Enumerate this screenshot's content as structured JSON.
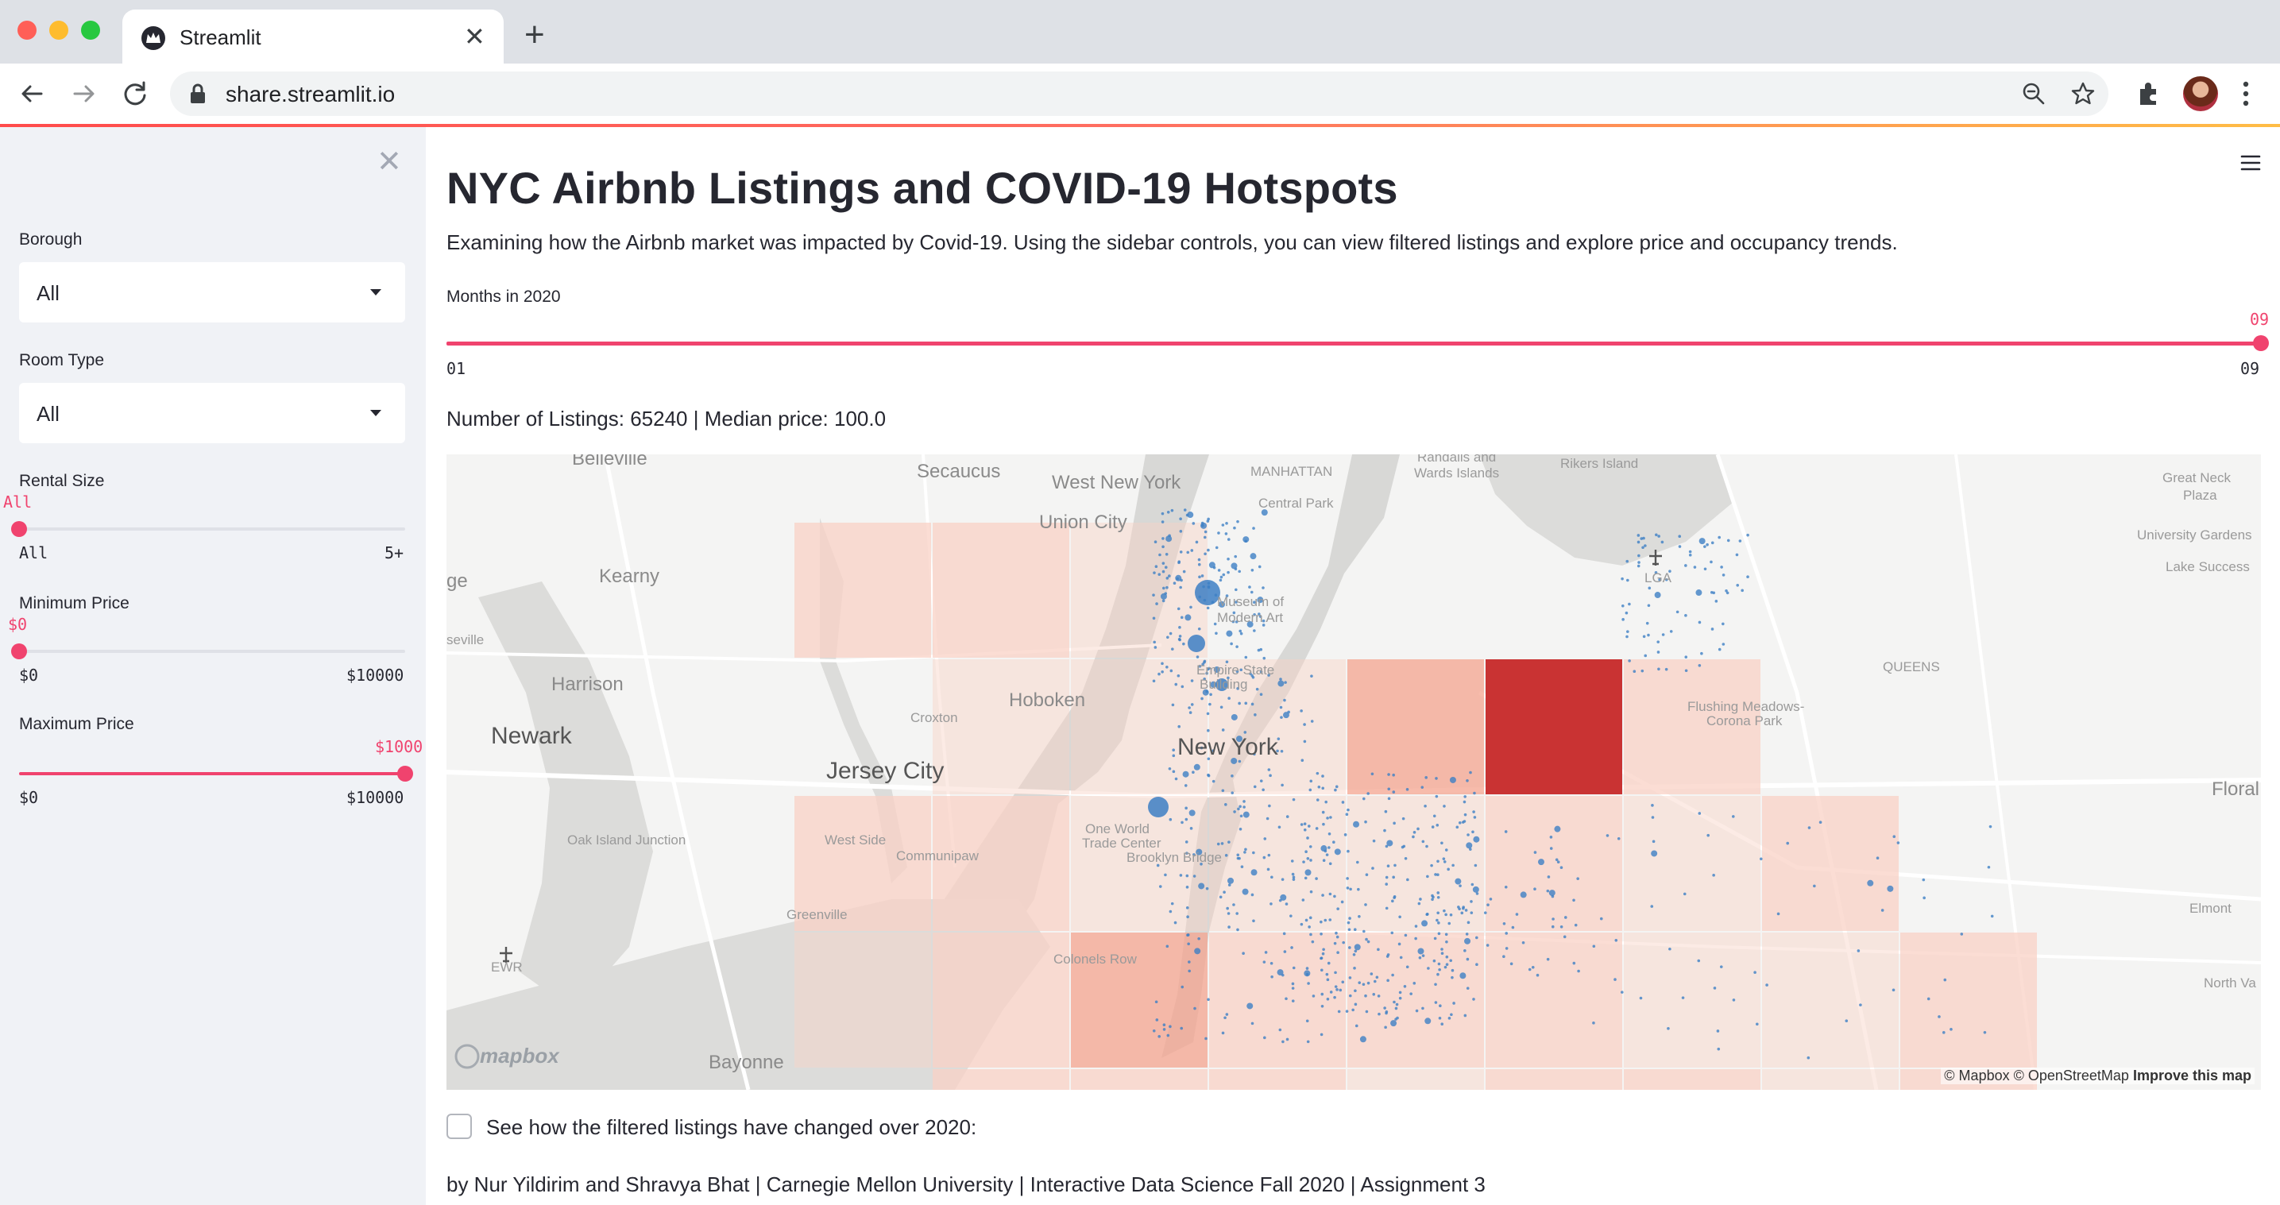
{
  "browser": {
    "tab_title": "Streamlit",
    "url": "share.streamlit.io",
    "icons": [
      "back-arrow-icon",
      "forward-arrow-icon",
      "reload-icon",
      "lock-icon",
      "zoom-icon",
      "star-icon",
      "extensions-icon",
      "profile-avatar",
      "kebab-menu-icon"
    ]
  },
  "sidebar": {
    "borough": {
      "label": "Borough",
      "value": "All"
    },
    "room_type": {
      "label": "Room Type",
      "value": "All"
    },
    "rental_size": {
      "label": "Rental Size",
      "value": "All",
      "min": "All",
      "max": "5+",
      "position": 0
    },
    "min_price": {
      "label": "Minimum Price",
      "value": "$0",
      "min": "$0",
      "max": "$10000",
      "position": 0
    },
    "max_price": {
      "label": "Maximum Price",
      "value": "$1000",
      "min": "$0",
      "max": "$10000",
      "position": 1
    }
  },
  "main": {
    "title": "NYC Airbnb Listings and COVID-19 Hotspots",
    "subtitle": "Examining how the Airbnb market was impacted by Covid-19. Using the sidebar controls, you can view filtered listings and explore price and occupancy trends.",
    "months_slider": {
      "label": "Months in 2020",
      "value": "09",
      "min": "01",
      "max": "09",
      "position": 1
    },
    "stats": "Number of Listings: 65240 | Median price: 100.0",
    "checkbox_label": "See how the filtered listings have changed over 2020:",
    "checkbox_checked": false,
    "footer": "by Nur Yildirim and Shravya Bhat | Carnegie Mellon University | Interactive Data Science Fall 2020 | Assignment 3"
  },
  "map": {
    "labels": {
      "belleville": "Belleville",
      "secaucus": "Secaucus",
      "west_new_york": "West New York",
      "manhattan": "MANHATTAN",
      "central_park": "Central Park",
      "randalls": "Randalls and",
      "wards": "Wards Islands",
      "rikers": "Rikers Island",
      "great_neck": "Great Neck",
      "plaza": "Plaza",
      "university_gardens": "University Gardens",
      "lake_success": "Lake Success",
      "union_city": "Union City",
      "kearny": "Kearny",
      "ge": "ge",
      "moma": "Museum of",
      "moma2": "Modern Art",
      "lga": "LGA",
      "seville": "seville",
      "harrison": "Harrison",
      "empire": "Empire State",
      "empire2": "Building",
      "queens": "QUEENS",
      "hoboken": "Hoboken",
      "flushing": "Flushing Meadows-",
      "corona": "Corona Park",
      "croxton": "Croxton",
      "newark": "Newark",
      "new_york": "New York",
      "jersey_city": "Jersey City",
      "floral": "Floral",
      "wtc": "One World",
      "wtc2": "Trade Center",
      "oak_island": "Oak Island Junction",
      "west_side": "West Side",
      "communipaw": "Communipaw",
      "brooklyn_bridge": "Brooklyn Bridge",
      "greenville": "Greenville",
      "elmont": "Elmont",
      "ewr": "EWR",
      "colonels_row": "Colonels Row",
      "north_va": "North Va",
      "bayonne": "Bayonne"
    },
    "logo": "mapbox",
    "attribution_text": "© Mapbox © OpenStreetMap",
    "attribution_link": "Improve this map",
    "colors": {
      "hot": "#c62828",
      "warm": "#f4a48f",
      "mild": "#f9d2c6",
      "point": "#3d7fc4"
    }
  }
}
